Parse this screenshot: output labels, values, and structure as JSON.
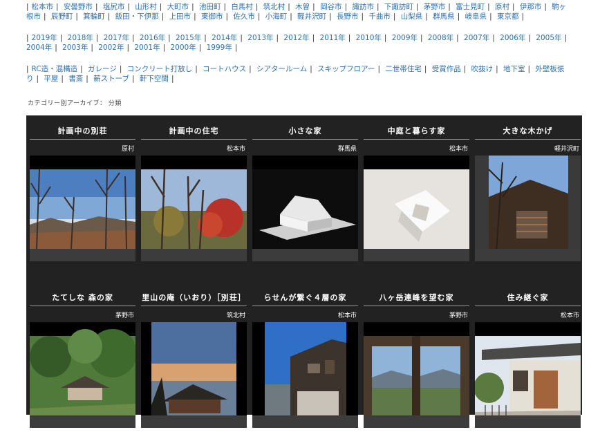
{
  "cities": [
    "松本市",
    "安曇野市",
    "塩尻市",
    "山形村",
    "大町市",
    "池田町",
    "白馬村",
    "筑北村",
    "木曽",
    "岡谷市",
    "諏訪市",
    "下諏訪町",
    "茅野市",
    "富士見町",
    "原村",
    "伊那市",
    "駒ヶ根市",
    "辰野町",
    "箕輪町",
    "飯田・下伊那",
    "上田市",
    "東御市",
    "佐久市",
    "小海町",
    "軽井沢町",
    "長野市",
    "千曲市",
    "山梨県",
    "群馬県",
    "岐阜県",
    "東京都"
  ],
  "years": [
    "2019年",
    "2018年",
    "2017年",
    "2016年",
    "2015年",
    "2014年",
    "2013年",
    "2012年",
    "2011年",
    "2010年",
    "2009年",
    "2008年",
    "2007年",
    "2006年",
    "2005年",
    "2004年",
    "2003年",
    "2002年",
    "2001年",
    "2000年",
    "1999年"
  ],
  "categories": [
    "RC造・混構造",
    "ガレージ",
    "コンクリート打放し",
    "コートハウス",
    "シアタールーム",
    "スキップフロアー",
    "二世帯住宅",
    "受賞作品",
    "吹抜け",
    "地下室",
    "外壁板張り",
    "平屋",
    "書斎",
    "薪ストーブ",
    "軒下空間"
  ],
  "archive_label": "カテゴリー別アーカイブ： 分類",
  "cards": [
    {
      "title": "計画中の別荘",
      "location": "原村"
    },
    {
      "title": "計画中の住宅",
      "location": "松本市"
    },
    {
      "title": "小さな家",
      "location": "群馬県"
    },
    {
      "title": "中庭と暮らす家",
      "location": "松本市"
    },
    {
      "title": "大きな木かげ",
      "location": "軽井沢町"
    },
    {
      "title": "たてしな 森の家",
      "location": "茅野市"
    },
    {
      "title": "里山の庵（いおり）［別荘］",
      "location": "筑北村"
    },
    {
      "title": "らせんが繋ぐ４層の家",
      "location": "松本市"
    },
    {
      "title": "八ヶ岳連峰を望む家",
      "location": "茅野市"
    },
    {
      "title": "住み継ぐ家",
      "location": "松本市"
    }
  ]
}
